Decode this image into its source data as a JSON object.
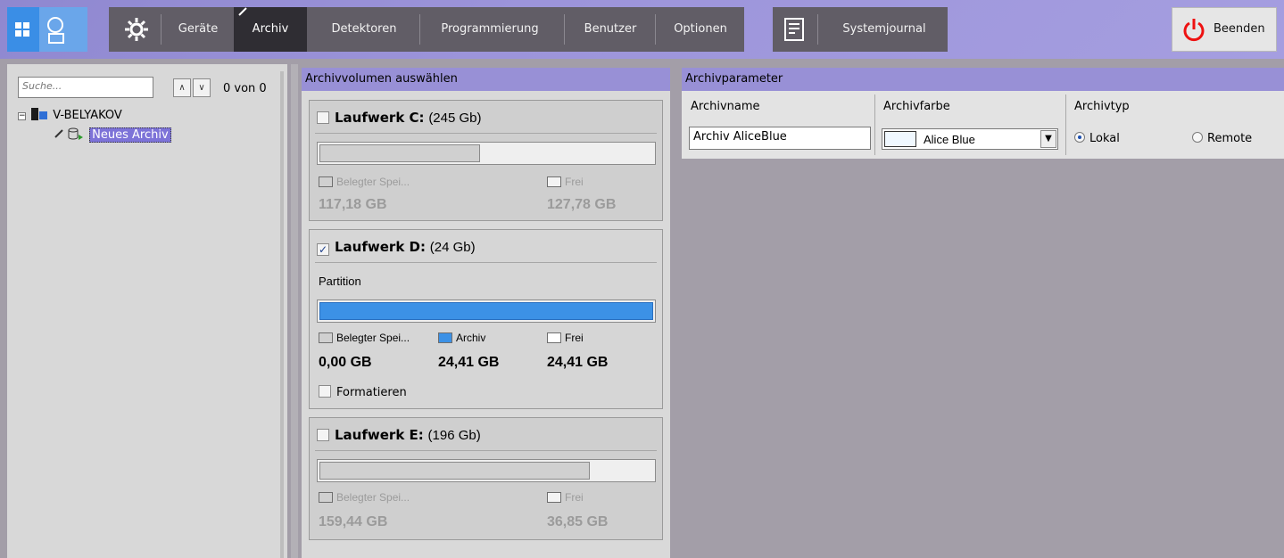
{
  "toolbar": {
    "items": [
      "Geräte",
      "Archiv",
      "Detektoren",
      "Programmierung",
      "Benutzer",
      "Optionen",
      "Systemjournal"
    ],
    "active": "Archiv",
    "quit_label": "Beenden"
  },
  "left": {
    "search_placeholder": "Suche...",
    "counter": "0 von 0",
    "tree": {
      "server": "V-BELYAKOV",
      "archive": "Neues Archiv"
    }
  },
  "volumes": {
    "header": "Archivvolumen auswählen",
    "drives": [
      {
        "name": "Laufwerk C:",
        "size": "(245 Gb)",
        "checked": false,
        "used_label": "Belegter Spei...",
        "free_label": "Frei",
        "used": "117,18 GB",
        "free": "127,78 GB",
        "used_fraction": 0.48
      },
      {
        "name": "Laufwerk D:",
        "size": "(24 Gb)",
        "checked": true,
        "partition_label": "Partition",
        "used_label": "Belegter Spei...",
        "archive_label": "Archiv",
        "free_label": "Frei",
        "used": "0,00 GB",
        "archive": "24,41 GB",
        "free": "24,41 GB",
        "archive_fraction": 1.0,
        "format_label": "Formatieren"
      },
      {
        "name": "Laufwerk E:",
        "size": "(196 Gb)",
        "checked": false,
        "used_label": "Belegter Spei...",
        "free_label": "Frei",
        "used": "159,44 GB",
        "free": "36,85 GB",
        "used_fraction": 0.81
      }
    ]
  },
  "params": {
    "header": "Archivparameter",
    "name_label": "Archivname",
    "name_value": "Archiv AliceBlue",
    "color_label": "Archivfarbe",
    "color_value": "Alice Blue",
    "color_swatch": "#F0F8FF",
    "type_label": "Archivtyp",
    "type_local": "Lokal",
    "type_remote": "Remote",
    "type_selected": "Lokal"
  },
  "colors": {
    "accent": "#9890D6",
    "toolbar": "#8F88D0",
    "selection": "#7D73D8",
    "progress_blue": "#3C91E6"
  }
}
